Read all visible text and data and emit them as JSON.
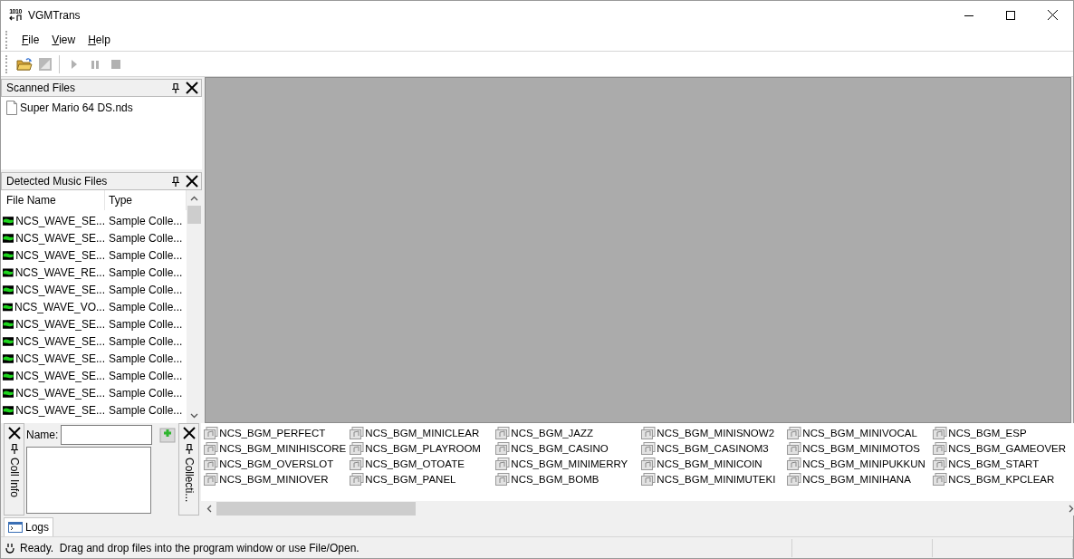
{
  "window": {
    "title": "VGMTrans",
    "icon_text": "1010"
  },
  "menu": [
    "File",
    "View",
    "Help"
  ],
  "toolbar": [
    {
      "kind": "open",
      "disabled": false
    },
    {
      "kind": "save",
      "disabled": true
    },
    {
      "kind": "play",
      "disabled": true
    },
    {
      "kind": "pause",
      "disabled": true
    },
    {
      "kind": "stop",
      "disabled": true
    }
  ],
  "scanned_files": {
    "title": "Scanned Files",
    "items": [
      "Super Mario 64 DS.nds"
    ]
  },
  "detected_music_files": {
    "title": "Detected Music Files",
    "columns": [
      "File Name",
      "Type"
    ],
    "rows": [
      {
        "file_name": "NCS_WAVE_SE...",
        "type": "Sample Colle..."
      },
      {
        "file_name": "NCS_WAVE_SE...",
        "type": "Sample Colle..."
      },
      {
        "file_name": "NCS_WAVE_SE...",
        "type": "Sample Colle..."
      },
      {
        "file_name": "NCS_WAVE_RE...",
        "type": "Sample Colle..."
      },
      {
        "file_name": "NCS_WAVE_SE...",
        "type": "Sample Colle..."
      },
      {
        "file_name": "NCS_WAVE_VO...",
        "type": "Sample Colle..."
      },
      {
        "file_name": "NCS_WAVE_SE...",
        "type": "Sample Colle..."
      },
      {
        "file_name": "NCS_WAVE_SE...",
        "type": "Sample Colle..."
      },
      {
        "file_name": "NCS_WAVE_SE...",
        "type": "Sample Colle..."
      },
      {
        "file_name": "NCS_WAVE_SE...",
        "type": "Sample Colle..."
      },
      {
        "file_name": "NCS_WAVE_SE...",
        "type": "Sample Colle..."
      },
      {
        "file_name": "NCS_WAVE_SE...",
        "type": "Sample Colle..."
      }
    ]
  },
  "coll_info": {
    "tab_label": "Coll Info",
    "name_label": "Name:"
  },
  "collections": {
    "tab_label": "Collecti...",
    "items": [
      "NCS_BGM_PERFECT",
      "NCS_BGM_MINIHISCORE",
      "NCS_BGM_OVERSLOT",
      "NCS_BGM_MINIOVER",
      "NCS_BGM_MINICLEAR",
      "NCS_BGM_PLAYROOM",
      "NCS_BGM_OTOATE",
      "NCS_BGM_PANEL",
      "NCS_BGM_JAZZ",
      "NCS_BGM_CASINO",
      "NCS_BGM_MINIMERRY",
      "NCS_BGM_BOMB",
      "NCS_BGM_MINISNOW2",
      "NCS_BGM_CASINOM3",
      "NCS_BGM_MINICOIN",
      "NCS_BGM_MINIMUTEKI",
      "NCS_BGM_MINIVOCAL",
      "NCS_BGM_MINIMOTOS",
      "NCS_BGM_MINIPUKKUN",
      "NCS_BGM_MINIHANA",
      "NCS_BGM_ESP",
      "NCS_BGM_GAMEOVER",
      "NCS_BGM_START",
      "NCS_BGM_KPCLEAR"
    ]
  },
  "bottom_tabs": [
    {
      "label": "Logs",
      "selected": true
    }
  ],
  "status_bar": {
    "message": "Ready.  Drag and drop files into the program window or use File/Open."
  }
}
